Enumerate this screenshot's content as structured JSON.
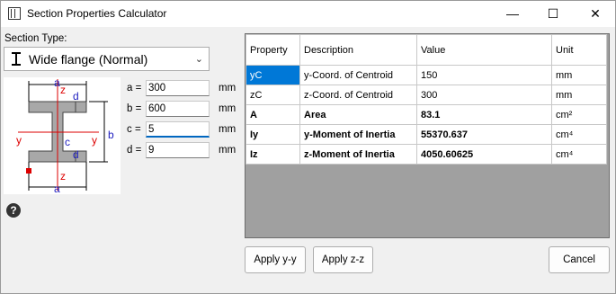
{
  "window": {
    "title": "Section Properties Calculator",
    "minimize": "—",
    "maximize": "☐",
    "close": "✕"
  },
  "section_type": {
    "label": "Section Type:",
    "value": "Wide flange (Normal)"
  },
  "diagram": {
    "a_top": "a",
    "a_bot": "a",
    "b": "b",
    "c": "c",
    "d_top": "d",
    "d_bot": "d",
    "y_left": "y",
    "y_right": "y",
    "z_top": "z",
    "z_bot": "z"
  },
  "params": [
    {
      "label": "a =",
      "value": "300",
      "unit": "mm"
    },
    {
      "label": "b =",
      "value": "600",
      "unit": "mm"
    },
    {
      "label": "c =",
      "value": "5",
      "unit": "mm"
    },
    {
      "label": "d =",
      "value": "9",
      "unit": "mm"
    }
  ],
  "help": "?",
  "grid": {
    "headers": [
      "Property",
      "Description",
      "Value",
      "Unit"
    ],
    "rows": [
      {
        "property": "yC",
        "description": "y-Coord. of Centroid",
        "value": "150",
        "unit": "mm"
      },
      {
        "property": "zC",
        "description": "z-Coord. of Centroid",
        "value": "300",
        "unit": "mm"
      },
      {
        "property": "A",
        "description": "Area",
        "value": "83.1",
        "unit": "cm²"
      },
      {
        "property": "Iy",
        "description": "y-Moment of Inertia",
        "value": "55370.637",
        "unit": "cm⁴"
      },
      {
        "property": "Iz",
        "description": "z-Moment of Inertia",
        "value": "4050.60625",
        "unit": "cm⁴"
      }
    ]
  },
  "buttons": {
    "apply_yy": "Apply y-y",
    "apply_zz": "Apply z-z",
    "cancel": "Cancel"
  }
}
